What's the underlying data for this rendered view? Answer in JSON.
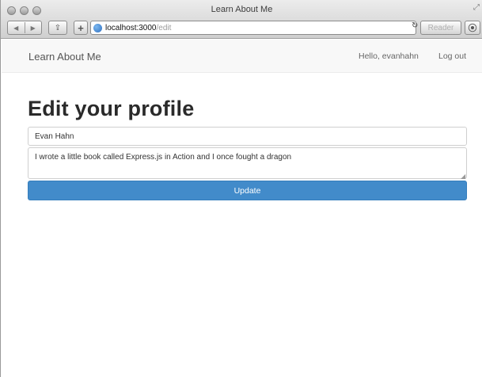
{
  "window": {
    "title": "Learn About Me",
    "url_host": "localhost:3000",
    "url_path": "/edit",
    "reader_label": "Reader"
  },
  "navbar": {
    "brand": "Learn About Me",
    "greeting": "Hello, evanhahn",
    "logout": "Log out"
  },
  "form": {
    "heading": "Edit your profile",
    "name_value": "Evan Hahn",
    "bio_value": "I wrote a little book called Express.js in Action and I once fought a dragon",
    "submit_label": "Update"
  },
  "colors": {
    "primary": "#428bca"
  }
}
